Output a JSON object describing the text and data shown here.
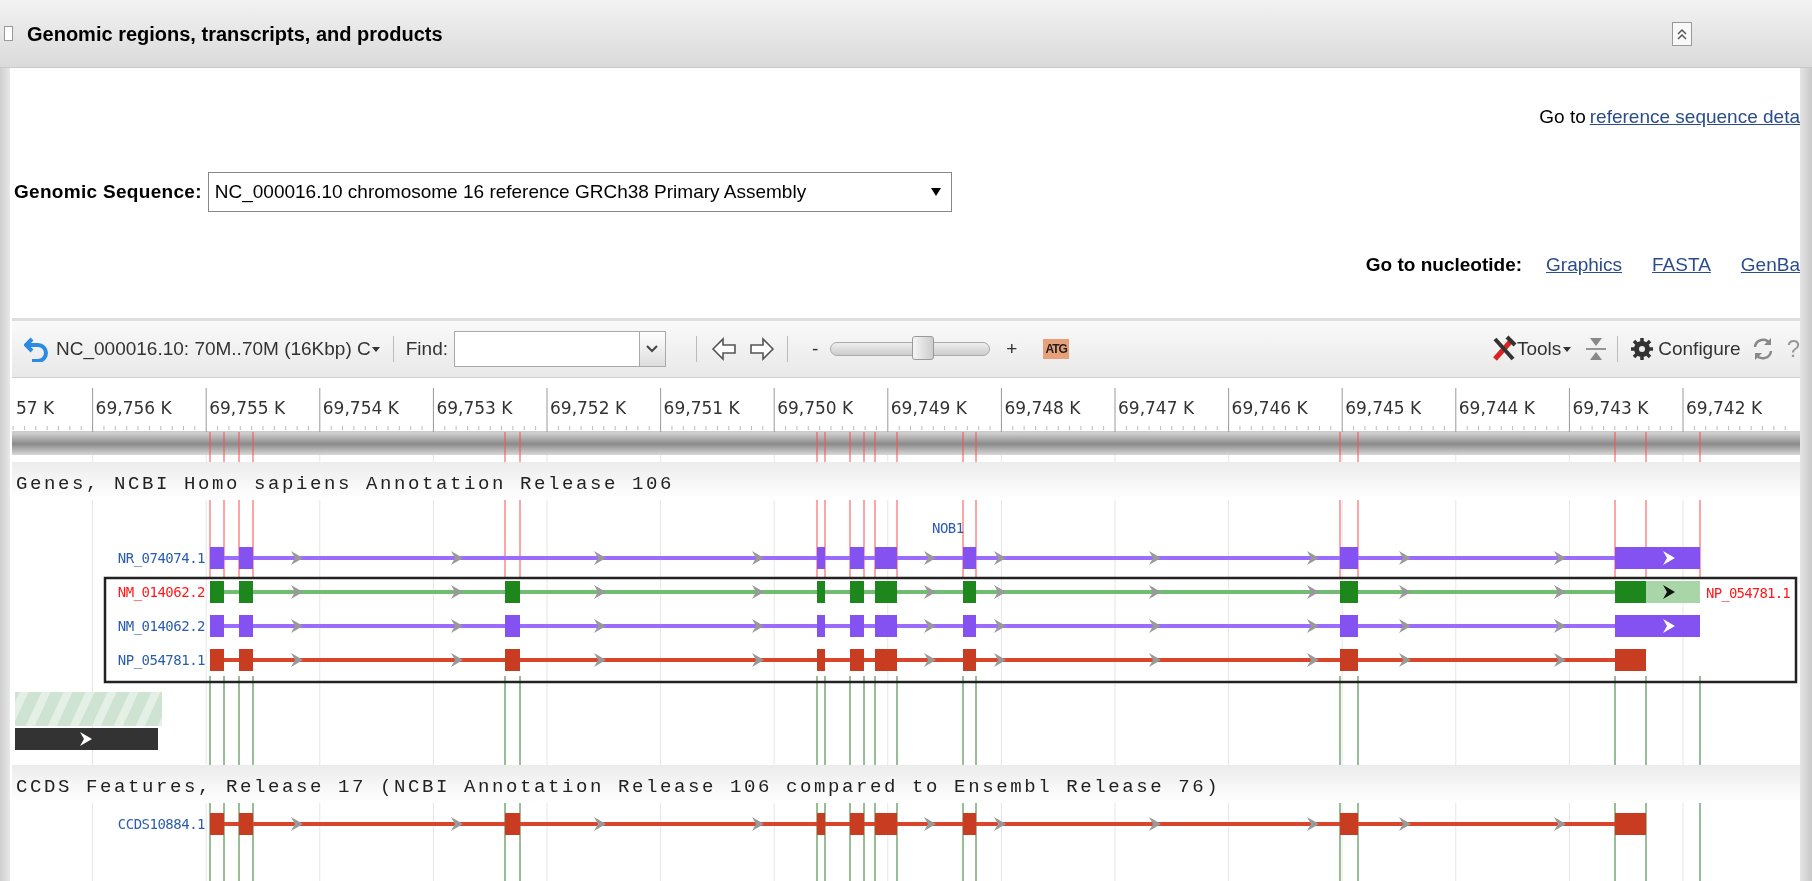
{
  "section": {
    "title": "Genomic regions, transcripts, and products"
  },
  "reference_link": {
    "prefix": "Go to",
    "link": "reference sequence deta"
  },
  "genomic_sequence": {
    "label": "Genomic Sequence:",
    "value": "NC_000016.10 chromosome 16 reference GRCh38 Primary Assembly"
  },
  "nucleotide_links": {
    "label": "Go to nucleotide:",
    "links": [
      "Graphics",
      "FASTA",
      "GenBa"
    ]
  },
  "viewer": {
    "toolbar": {
      "region": "NC_000016.10: 70M..70M (16Kbp) C",
      "find_label": "Find:",
      "zoom_out": "-",
      "zoom": {
        "level": 0.58
      },
      "zoom_in": "+",
      "sequence_button": "ATG",
      "tools": "Tools",
      "configure": "Configure",
      "help": "?"
    },
    "ruler": [
      "57 K",
      "69,756 K",
      "69,755 K",
      "69,754 K",
      "69,753 K",
      "69,752 K",
      "69,751 K",
      "69,750 K",
      "69,749 K",
      "69,748 K",
      "69,747 K",
      "69,746 K",
      "69,745 K",
      "69,744 K",
      "69,743 K",
      "69,742 K"
    ],
    "tracks": [
      {
        "title": "Genes, NCBI Homo sapiens Annotation Release 106",
        "gene": "NOB1",
        "transcripts": [
          {
            "label": "NR_074074.1",
            "kind": "ncrna",
            "selected": false
          }
        ],
        "selection": {
          "product_label": "NP_054781.1",
          "transcripts": [
            {
              "label": "NM_014062.2",
              "kind": "mrna",
              "selected": true
            },
            {
              "label": "NM_014062.2",
              "kind": "mrna",
              "selected": false
            },
            {
              "label": "NP_054781.1",
              "kind": "protein",
              "selected": false
            }
          ]
        }
      },
      {
        "title": "CCDS Features, Release 17 (NCBI Annotation Release 106 compared to Ensembl Release 76)",
        "transcripts": [
          {
            "label": "CCDS10884.1",
            "kind": "protein",
            "selected": false
          }
        ]
      }
    ]
  }
}
